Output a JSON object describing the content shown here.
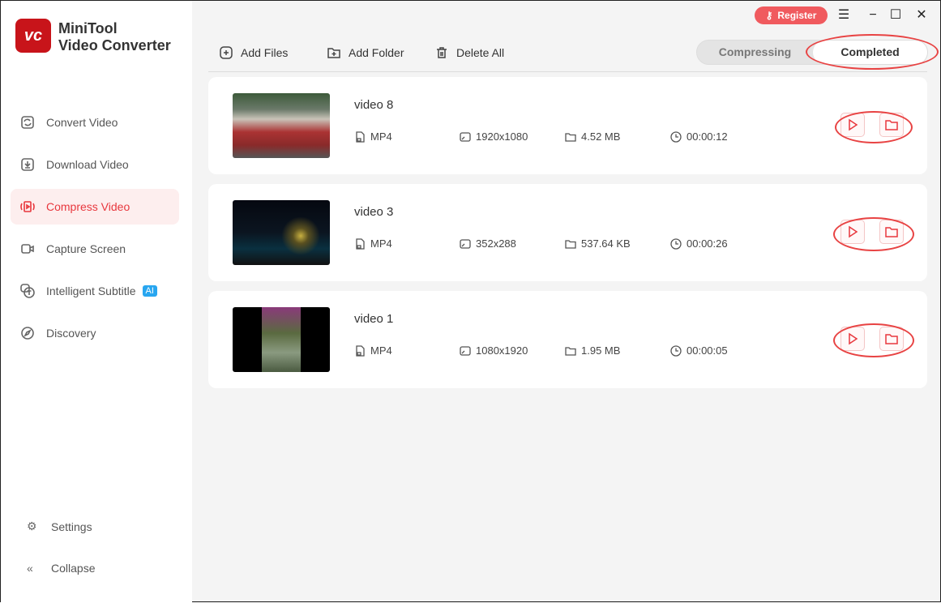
{
  "app": {
    "logo_text": "vc",
    "name_line1": "MiniTool",
    "name_line2": "Video Converter"
  },
  "titlebar": {
    "register": "Register"
  },
  "sidebar": {
    "items": [
      {
        "label": "Convert Video"
      },
      {
        "label": "Download Video"
      },
      {
        "label": "Compress Video"
      },
      {
        "label": "Capture Screen"
      },
      {
        "label": "Intelligent Subtitle",
        "badge": "AI"
      },
      {
        "label": "Discovery"
      }
    ],
    "settings": "Settings",
    "collapse": "Collapse"
  },
  "toolbar": {
    "add_files": "Add Files",
    "add_folder": "Add Folder",
    "delete_all": "Delete All"
  },
  "tabs": {
    "compressing": "Compressing",
    "completed": "Completed"
  },
  "videos": [
    {
      "name": "video 8",
      "format": "MP4",
      "resolution": "1920x1080",
      "size": "4.52 MB",
      "duration": "00:00:12"
    },
    {
      "name": "video 3",
      "format": "MP4",
      "resolution": "352x288",
      "size": "537.64 KB",
      "duration": "00:00:26"
    },
    {
      "name": "video 1",
      "format": "MP4",
      "resolution": "1080x1920",
      "size": "1.95 MB",
      "duration": "00:00:05"
    }
  ],
  "colors": {
    "accent": "#e8373d",
    "annotation": "#e84343"
  }
}
